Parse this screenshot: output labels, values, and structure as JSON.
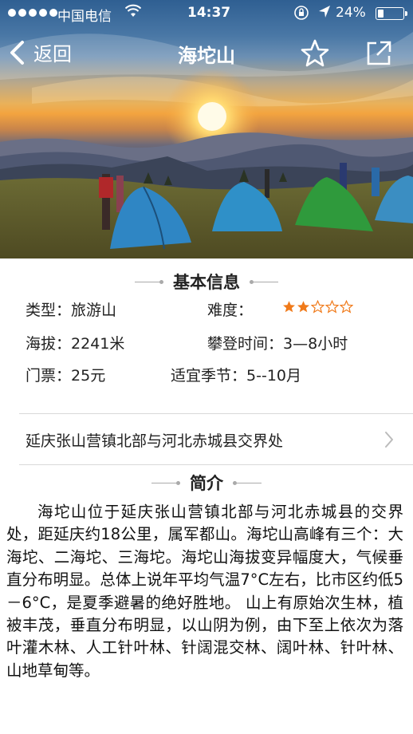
{
  "status_bar": {
    "carrier": "中国电信",
    "time": "14:37",
    "battery": "24%",
    "battery_level": 0.24,
    "signal_bars": 5
  },
  "nav": {
    "back_label": "返回",
    "title": "海坨山",
    "icons": [
      "chevron-left-icon",
      "star-outline-icon",
      "share-icon"
    ]
  },
  "basic_info": {
    "heading": "基本信息",
    "type_label": "类型：",
    "type_value": "旅游山",
    "difficulty_label": "难度：",
    "difficulty_rating": 2,
    "difficulty_max": 5,
    "altitude_label": "海拔：",
    "altitude_value": "2241米",
    "climb_time_label": "攀登时间：",
    "climb_time_value": "3—8小时",
    "ticket_label": "门票：",
    "ticket_value": "25元",
    "season_label": "适宜季节：",
    "season_value": "5--10月"
  },
  "location": {
    "text": "延庆张山营镇北部与河北赤城县交界处"
  },
  "intro": {
    "heading": "简介",
    "text": "海坨山位于延庆张山营镇北部与河北赤城县的交界处，距延庆约18公里，属军都山。海坨山高峰有三个：大海坨、二海坨、三海坨。海坨山海拔变异幅度大，气候垂直分布明显。总体上说年平均气温7°C左右，比市区约低5－6°C，是夏季避暑的绝好胜地。 山上有原始次生林，植被丰茂，垂直分布明显，以山阴为例，由下至上依次为落叶灌木林、人工针叶林、针阔混交林、阔叶林、针叶林、山地草甸等。"
  },
  "colors": {
    "star_filled": "#f07a1a",
    "star_empty": "#f07a1a",
    "divider": "#d8d8d8"
  }
}
